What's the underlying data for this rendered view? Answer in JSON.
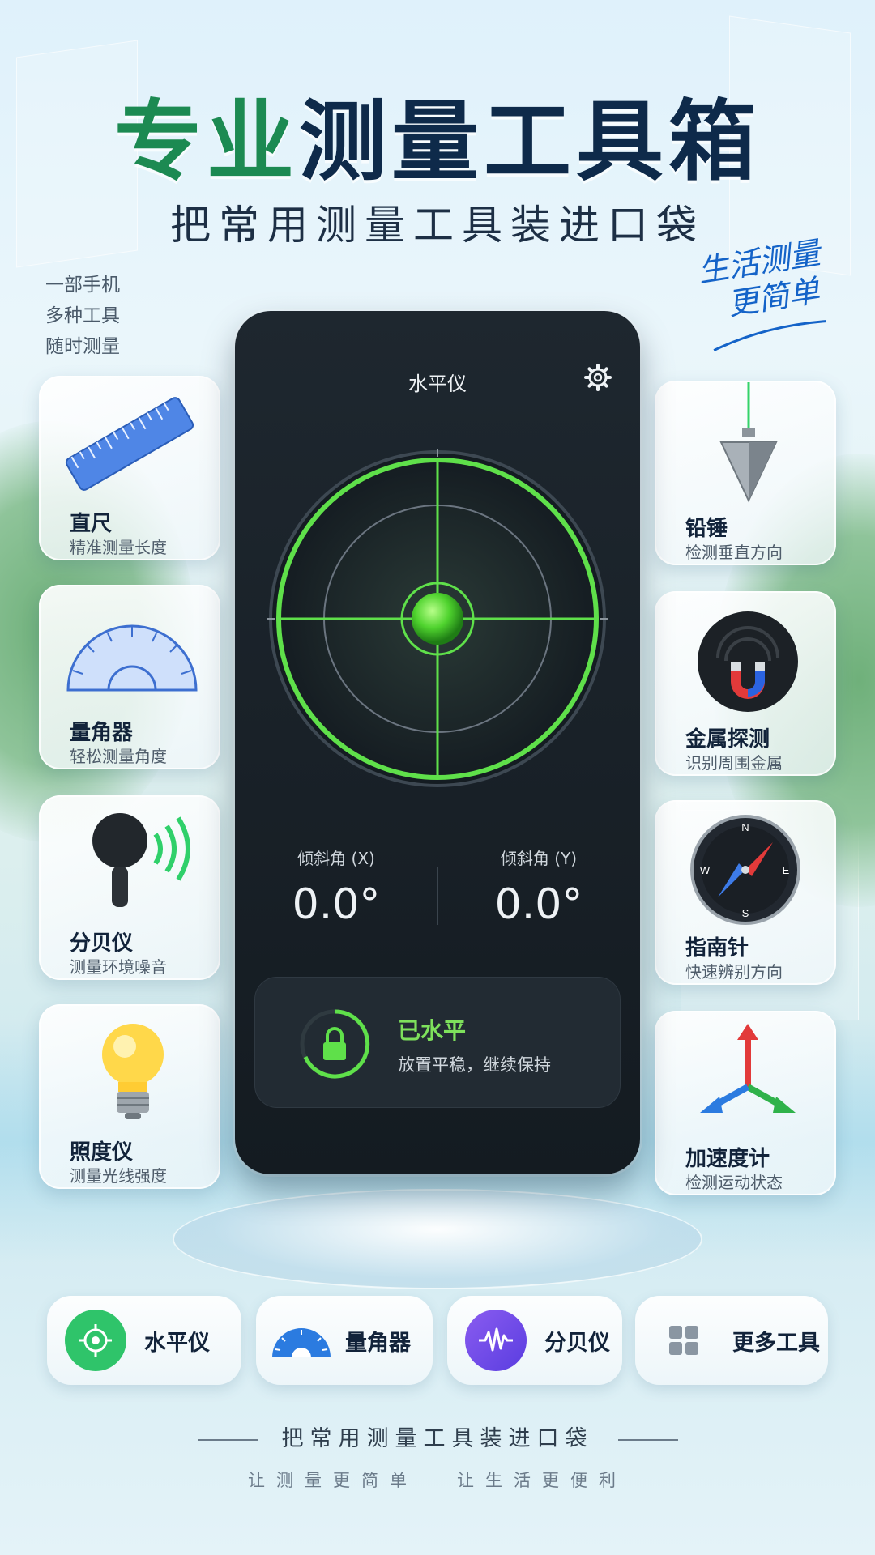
{
  "header": {
    "title_part1": "专业",
    "title_part2": "测量工具箱",
    "subtitle": "把常用测量工具装进口袋"
  },
  "left_tags": [
    "一部手机",
    "多种工具",
    "随时测量"
  ],
  "slogan": [
    "生活测量",
    "更简单"
  ],
  "left_cards": [
    {
      "name": "直尺",
      "desc": "精准测量长度",
      "icon": "ruler-icon"
    },
    {
      "name": "量角器",
      "desc": "轻松测量角度",
      "icon": "protractor-icon"
    },
    {
      "name": "分贝仪",
      "desc": "测量环境噪音",
      "icon": "microphone-icon"
    },
    {
      "name": "照度仪",
      "desc": "测量光线强度",
      "icon": "lightbulb-icon"
    }
  ],
  "right_cards": [
    {
      "name": "铅锤",
      "desc": "检测垂直方向",
      "icon": "plumb-bob-icon"
    },
    {
      "name": "金属探测",
      "desc": "识别周围金属",
      "icon": "magnet-icon"
    },
    {
      "name": "指南针",
      "desc": "快速辨别方向",
      "icon": "compass-icon"
    },
    {
      "name": "加速度计",
      "desc": "检测运动状态",
      "icon": "axes-icon"
    }
  ],
  "phone": {
    "title": "水平仪",
    "settings_icon": "gear-icon",
    "tilt_x_label": "倾斜角 (X)",
    "tilt_x_value": "0.0°",
    "tilt_y_label": "倾斜角 (Y)",
    "tilt_y_value": "0.0°",
    "status_title": "已水平",
    "status_desc": "放置平稳，继续保持",
    "status_icon": "lock-icon",
    "accent": "#5fe04a"
  },
  "compass_letters": {
    "n": "N",
    "e": "E",
    "s": "S",
    "w": "W"
  },
  "bottom_buttons": [
    {
      "label": "水平仪",
      "icon": "level-target-icon"
    },
    {
      "label": "量角器",
      "icon": "protractor-icon"
    },
    {
      "label": "分贝仪",
      "icon": "waveform-icon"
    },
    {
      "label": "更多工具",
      "icon": "grid-icon"
    }
  ],
  "footer": {
    "line1": "把常用测量工具装进口袋",
    "line2_a": "让测量更简单",
    "line2_b": "让生活更便利"
  }
}
